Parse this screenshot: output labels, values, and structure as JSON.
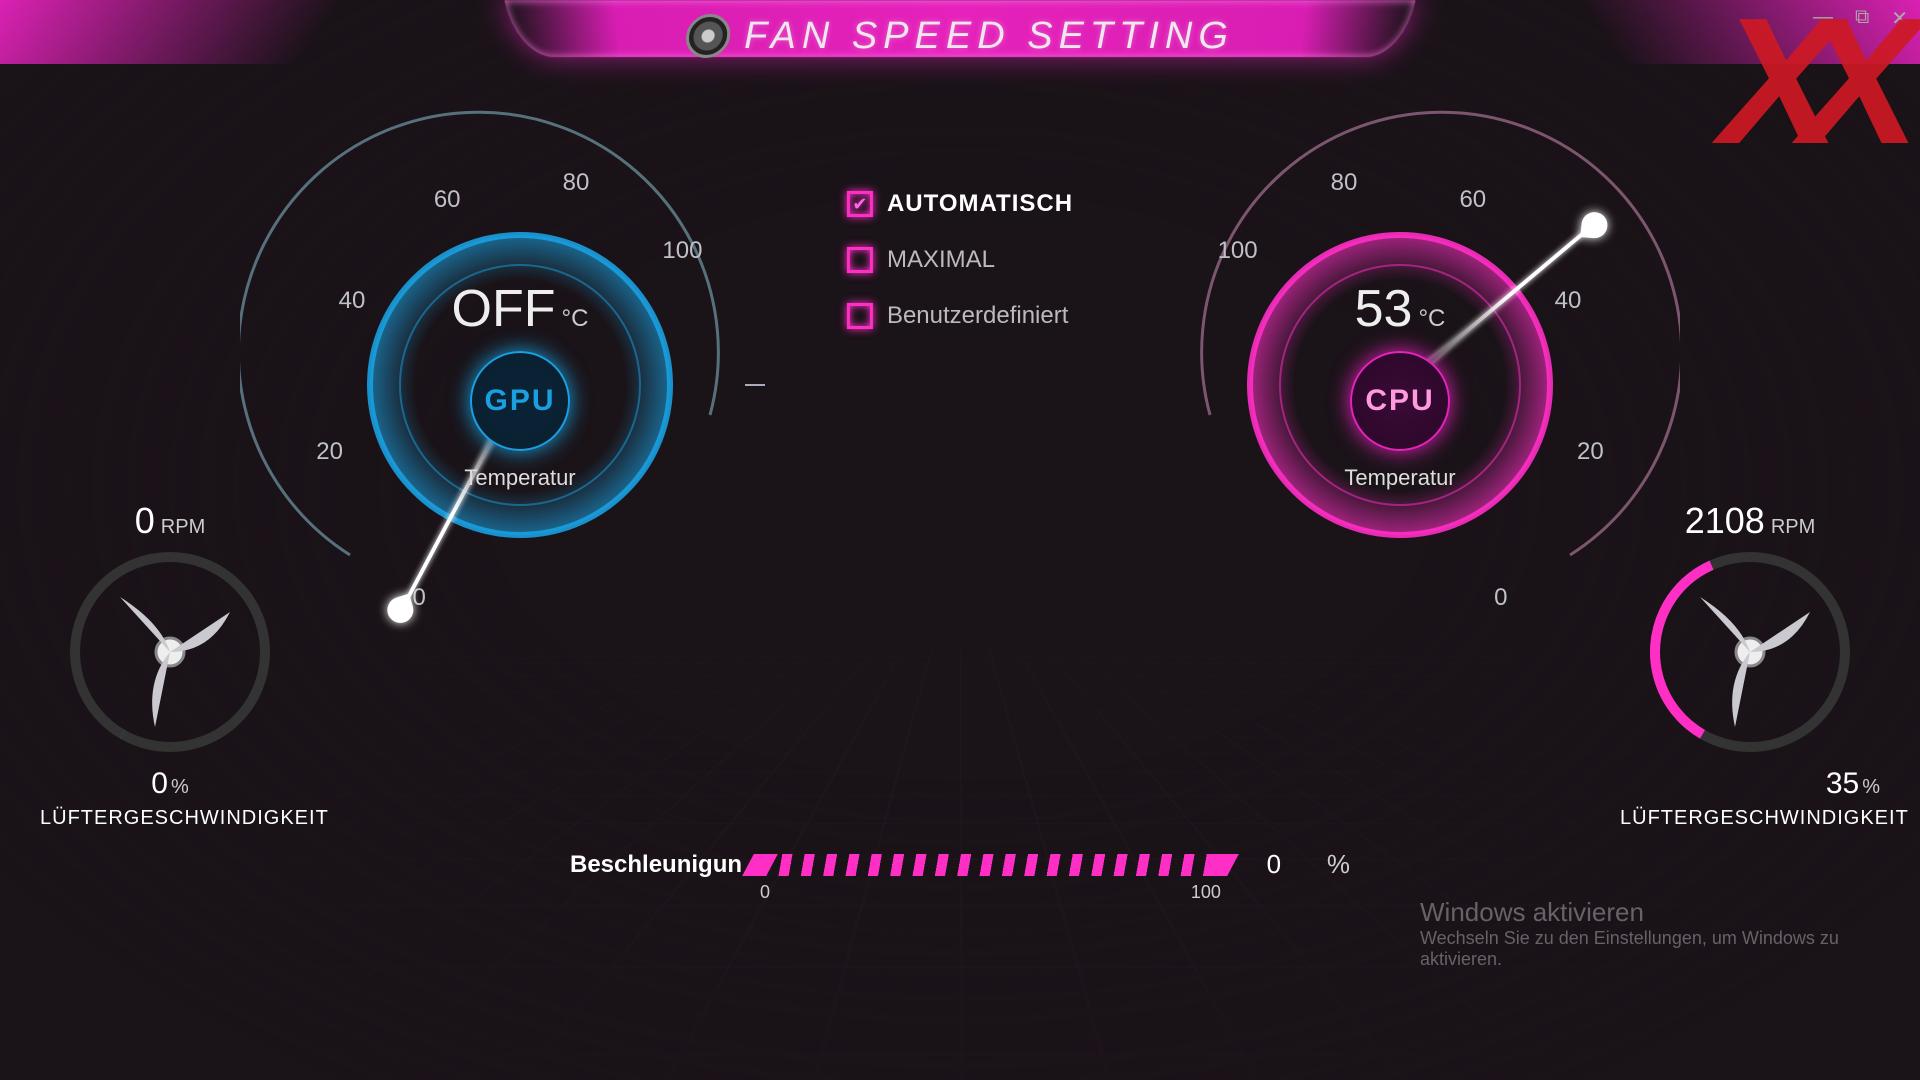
{
  "header": {
    "title": "FAN SPEED SETTING"
  },
  "win": {
    "minimize": "—",
    "maximize": "⧉",
    "close": "✕"
  },
  "logo": "XX",
  "modes": {
    "automatic": {
      "label": "AUTOMATISCH",
      "checked": true
    },
    "maximal": {
      "label": "MAXIMAL",
      "checked": false
    },
    "custom": {
      "label": "Benutzerdefiniert",
      "checked": false
    }
  },
  "gauge_ticks": {
    "t0": "0",
    "t20": "20",
    "t40": "40",
    "t60": "60",
    "t80": "80",
    "t100": "100"
  },
  "gpu": {
    "name": "GPU",
    "temp_display": "OFF",
    "temp_unit": "°C",
    "sub": "Temperatur",
    "needle_deg": 118,
    "fan": {
      "rpm": "0",
      "rpm_unit": "RPM",
      "pct": "0",
      "pct_unit": "%",
      "label": "LÜFTERGESCHWINDIGKEIT",
      "arc_pct": 0
    }
  },
  "cpu": {
    "name": "CPU",
    "temp_display": "53",
    "temp_unit": "°C",
    "sub": "Temperatur",
    "needle_deg": -40,
    "fan": {
      "rpm": "2108",
      "rpm_unit": "RPM",
      "pct": "35",
      "pct_unit": "%",
      "label": "LÜFTERGESCHWINDIGKEIT",
      "arc_pct": 35
    }
  },
  "slider": {
    "label": "Beschleunigun",
    "min": "0",
    "max": "100",
    "value": "0",
    "unit": "%"
  },
  "watermark": {
    "title": "Windows aktivieren",
    "sub": "Wechseln Sie zu den Einstellungen, um Windows zu aktivieren."
  },
  "colors": {
    "pink": "#ff2fc5",
    "cyan": "#1aa0e0"
  }
}
